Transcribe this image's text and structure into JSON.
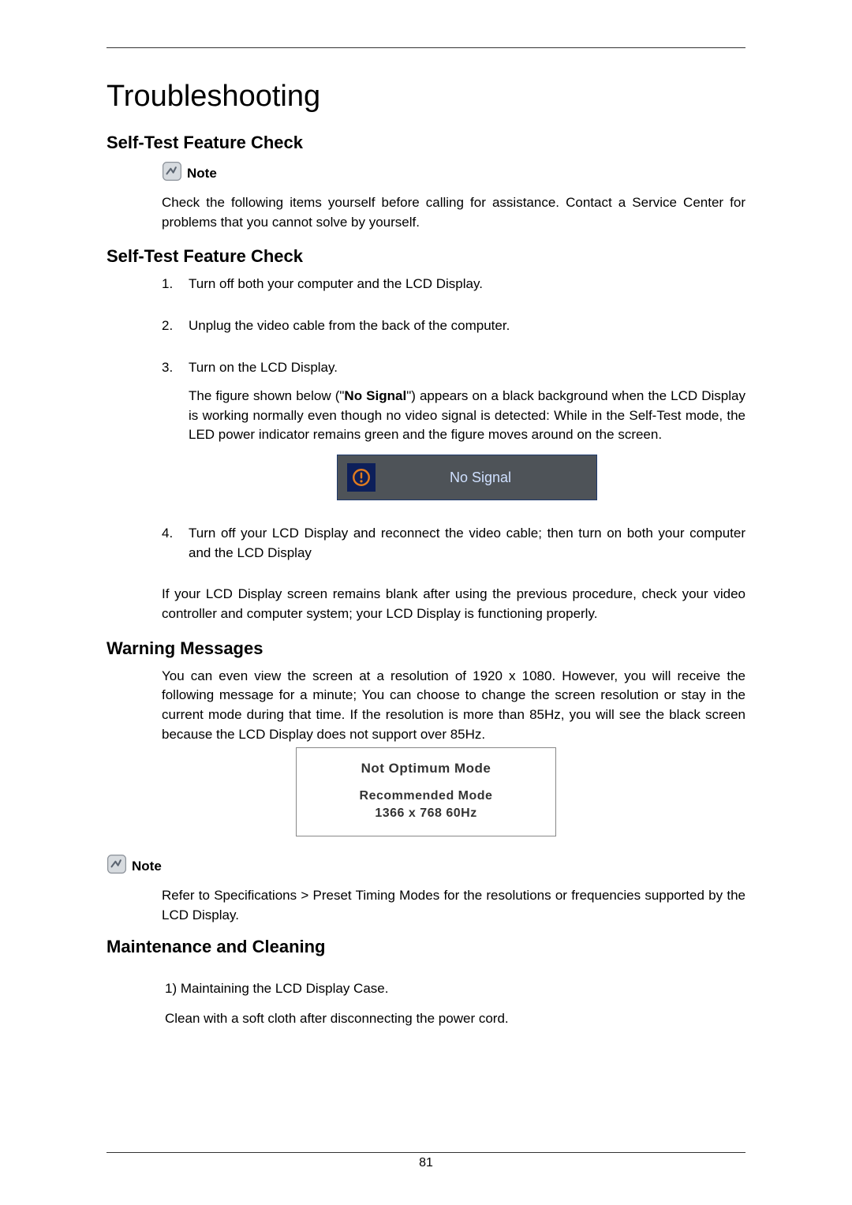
{
  "title": "Troubleshooting",
  "note_label": "Note",
  "sections": {
    "selftest1": {
      "heading": "Self-Test Feature Check",
      "intro": "Check the following items yourself before calling for assistance. Contact a Service Center for problems that you cannot solve by yourself."
    },
    "selftest2": {
      "heading": "Self-Test Feature Check",
      "items": [
        {
          "num": "1.",
          "text": "Turn off both your computer and the LCD Display."
        },
        {
          "num": "2.",
          "text": "Unplug the video cable from the back of the computer."
        },
        {
          "num": "3.",
          "text": "Turn on the LCD Display.",
          "extra": "The figure shown below (\"No Signal\") appears on a black background when the LCD Display is working normally even though no video signal is detected: While in the Self-Test mode, the LED power indicator remains green and the figure moves around on the screen.",
          "extra_bold_phrase": "No Signal"
        },
        {
          "num": "4.",
          "text": "Turn off your LCD Display and reconnect the video cable; then turn on both your computer and the LCD Display"
        }
      ],
      "no_signal_label": "No Signal",
      "after_list": "If your LCD Display screen remains blank after using the previous procedure, check your video controller and computer system; your LCD Display is functioning properly."
    },
    "warning": {
      "heading": "Warning Messages",
      "body": "You can even view the screen at a resolution of 1920 x 1080. However, you will receive the following message for a minute; You can choose to change the screen resolution or stay in the current mode during that time. If the resolution is more than 85Hz, you will see the black screen because the LCD Display does not support over 85Hz.",
      "box": {
        "line1": "Not Optimum Mode",
        "line2": "Recommended Mode",
        "line3": "1366 x 768  60Hz"
      },
      "note_body": "Refer to Specifications > Preset Timing Modes for the resolutions or frequencies supported by the LCD Display."
    },
    "maint": {
      "heading": "Maintenance and Cleaning",
      "p1": "1) Maintaining the LCD Display Case.",
      "p2": "Clean with a soft cloth after disconnecting the power cord."
    }
  },
  "page_number": "81"
}
